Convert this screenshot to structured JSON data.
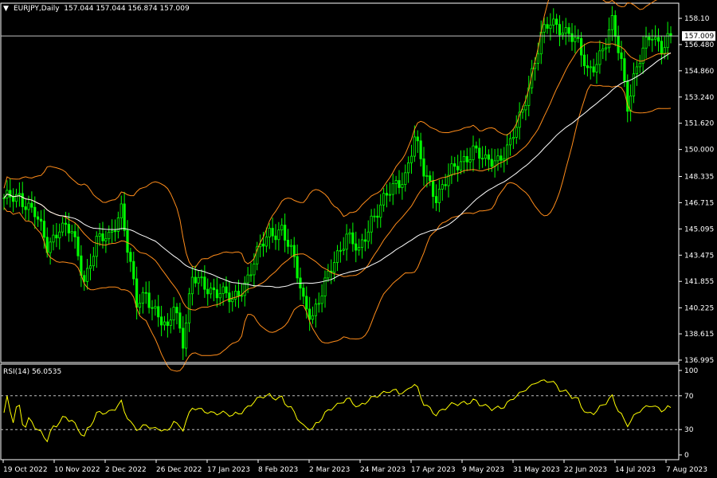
{
  "header": {
    "symbol_line": "EURJPY,Daily  157.044 157.044 156.874 157.009",
    "rsi_line": "RSI(14) 56.0535"
  },
  "current_price_label": "157.009",
  "colors": {
    "background": "#000000",
    "frame": "#ffffff",
    "candle_up": "#00ff00",
    "candle_down": "#00ff00",
    "bollinger": "#ff8c1a",
    "moving_average": "#ffffff",
    "rsi_line": "#ffff00",
    "price_line": "#c0c0c0"
  },
  "chart_data": [
    {
      "type": "candlestick",
      "title": "EURJPY,Daily",
      "grid": false,
      "ylim": [
        136.995,
        158.1
      ],
      "y_ticks": [
        158.1,
        156.48,
        154.86,
        153.24,
        151.62,
        150.0,
        148.335,
        146.715,
        145.095,
        143.475,
        141.855,
        140.225,
        138.615,
        136.995
      ],
      "y_tick_labels": [
        "158.10",
        "156.480",
        "154.860",
        "153.240",
        "151.620",
        "150.000",
        "148.335",
        "146.715",
        "145.095",
        "143.475",
        "141.855",
        "140.225",
        "138.615",
        "136.995"
      ],
      "x_tick_labels": [
        "19 Oct 2022",
        "10 Nov 2022",
        "2 Dec 2022",
        "26 Dec 2022",
        "17 Jan 2023",
        "8 Feb 2023",
        "2 Mar 2023",
        "24 Mar 2023",
        "17 Apr 2023",
        "9 May 2023",
        "31 May 2023",
        "22 Jun 2023",
        "14 Jul 2023",
        "7 Aug 2023"
      ],
      "last_price": 157.009,
      "close_anchors": [
        [
          0,
          146.8
        ],
        [
          5,
          147.2
        ],
        [
          10,
          146.0
        ],
        [
          14,
          144.0
        ],
        [
          18,
          145.3
        ],
        [
          22,
          144.8
        ],
        [
          26,
          142.0
        ],
        [
          30,
          144.3
        ],
        [
          34,
          144.5
        ],
        [
          38,
          146.5
        ],
        [
          40,
          143.9
        ],
        [
          43,
          140.3
        ],
        [
          46,
          141.2
        ],
        [
          50,
          139.7
        ],
        [
          53,
          138.6
        ],
        [
          55,
          140.5
        ],
        [
          58,
          138.3
        ],
        [
          61,
          142.0
        ],
        [
          65,
          141.5
        ],
        [
          70,
          141.3
        ],
        [
          74,
          140.5
        ],
        [
          78,
          141.8
        ],
        [
          82,
          143.5
        ],
        [
          86,
          144.8
        ],
        [
          90,
          145.2
        ],
        [
          94,
          143.0
        ],
        [
          97,
          140.7
        ],
        [
          100,
          139.8
        ],
        [
          103,
          141.0
        ],
        [
          107,
          143.2
        ],
        [
          111,
          144.8
        ],
        [
          115,
          143.5
        ],
        [
          119,
          145.8
        ],
        [
          123,
          146.8
        ],
        [
          127,
          147.8
        ],
        [
          130,
          148.5
        ],
        [
          133,
          150.7
        ],
        [
          136,
          148.5
        ],
        [
          140,
          147.2
        ],
        [
          144,
          148.3
        ],
        [
          148,
          149.2
        ],
        [
          152,
          150.1
        ],
        [
          156,
          149.1
        ],
        [
          160,
          149.5
        ],
        [
          164,
          150.3
        ],
        [
          168,
          152.3
        ],
        [
          171,
          154.9
        ],
        [
          174,
          157.0
        ],
        [
          177,
          157.7
        ],
        [
          180,
          157.6
        ],
        [
          183,
          157.3
        ],
        [
          186,
          156.3
        ],
        [
          189,
          154.8
        ],
        [
          192,
          155.6
        ],
        [
          195,
          156.5
        ],
        [
          197,
          157.7
        ],
        [
          200,
          155.5
        ],
        [
          202,
          152.9
        ],
        [
          204,
          154.4
        ],
        [
          207,
          156.0
        ],
        [
          210,
          157.2
        ],
        [
          213,
          156.4
        ],
        [
          216,
          157.0
        ]
      ],
      "series": [
        {
          "name": "RSI(14)",
          "last": 56.0535
        }
      ]
    },
    {
      "type": "line",
      "title": "RSI(14) 56.0535",
      "ylim": [
        0,
        100
      ],
      "y_ticks": [
        100,
        70,
        30,
        0
      ],
      "y_tick_labels": [
        "100",
        "70",
        "30",
        "0"
      ],
      "levels": [
        70,
        30
      ]
    }
  ]
}
